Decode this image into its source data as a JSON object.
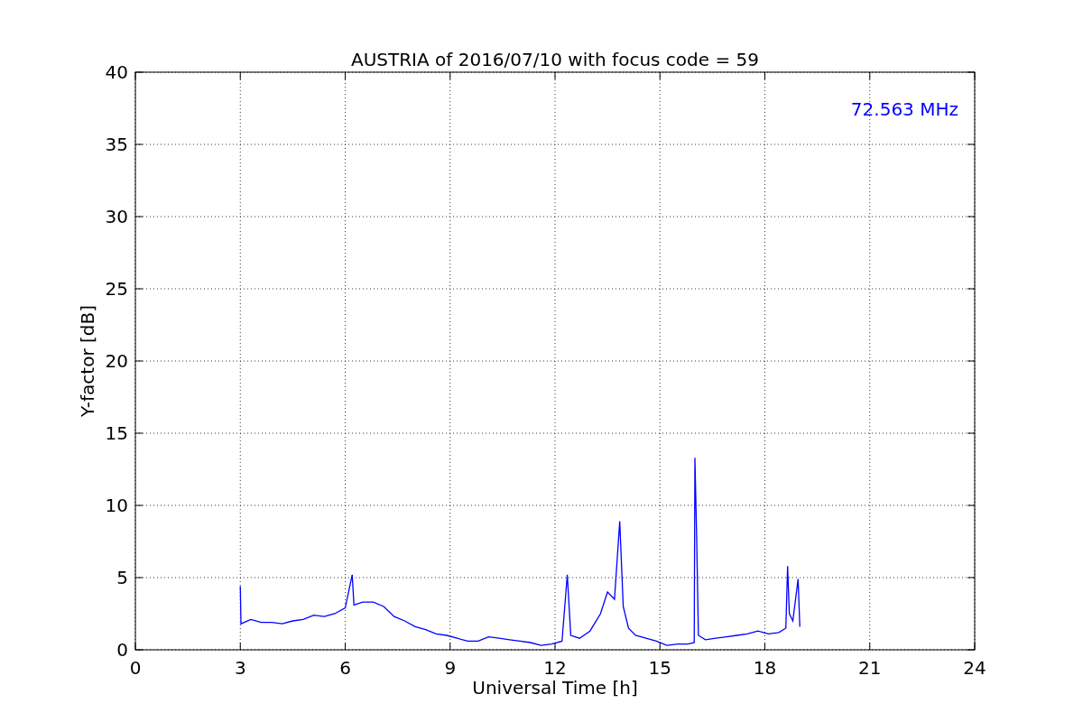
{
  "figure": {
    "chart_data": {
      "type": "line",
      "title": "AUSTRIA of 2016/07/10 with focus code = 59",
      "xlabel": "Universal Time [h]",
      "ylabel": "Y-factor [dB]",
      "x": [
        3,
        3.02,
        3.3,
        3.6,
        3.9,
        4.2,
        4.5,
        4.8,
        5.1,
        5.4,
        5.7,
        6.0,
        6.2,
        6.25,
        6.5,
        6.8,
        7.1,
        7.4,
        7.7,
        8.0,
        8.3,
        8.6,
        8.9,
        9.2,
        9.5,
        9.8,
        10.1,
        10.4,
        10.7,
        11.0,
        11.3,
        11.6,
        11.9,
        12.2,
        12.35,
        12.45,
        12.7,
        13.0,
        13.3,
        13.5,
        13.7,
        13.85,
        13.95,
        14.1,
        14.3,
        14.6,
        14.9,
        15.2,
        15.5,
        15.8,
        15.98,
        16.0,
        16.05,
        16.1,
        16.3,
        16.6,
        16.9,
        17.2,
        17.5,
        17.8,
        18.1,
        18.4,
        18.6,
        18.65,
        18.7,
        18.8,
        18.95,
        19.0
      ],
      "series": [
        {
          "color": "#0000ff",
          "values": [
            4.4,
            1.8,
            2.1,
            1.9,
            1.9,
            1.8,
            2.0,
            2.1,
            2.4,
            2.3,
            2.5,
            2.9,
            5.2,
            3.1,
            3.3,
            3.3,
            3.0,
            2.3,
            2.0,
            1.6,
            1.4,
            1.1,
            1.0,
            0.8,
            0.6,
            0.6,
            0.9,
            0.8,
            0.7,
            0.6,
            0.5,
            0.3,
            0.4,
            0.6,
            5.2,
            1.0,
            0.8,
            1.3,
            2.5,
            4.0,
            3.5,
            8.9,
            3.0,
            1.5,
            1.0,
            0.8,
            0.6,
            0.3,
            0.4,
            0.4,
            0.5,
            13.3,
            7.7,
            1.0,
            0.7,
            0.8,
            0.9,
            1.0,
            1.1,
            1.3,
            1.1,
            1.2,
            1.5,
            5.8,
            2.5,
            2.0,
            4.9,
            1.6
          ]
        }
      ],
      "xlim": [
        0,
        24
      ],
      "ylim": [
        0,
        40
      ],
      "xticks": [
        0,
        3,
        6,
        9,
        12,
        15,
        18,
        21,
        24
      ],
      "yticks": [
        0,
        5,
        10,
        15,
        20,
        25,
        30,
        35,
        40
      ],
      "grid": true,
      "annotations": [
        "72.563 MHz"
      ]
    }
  }
}
